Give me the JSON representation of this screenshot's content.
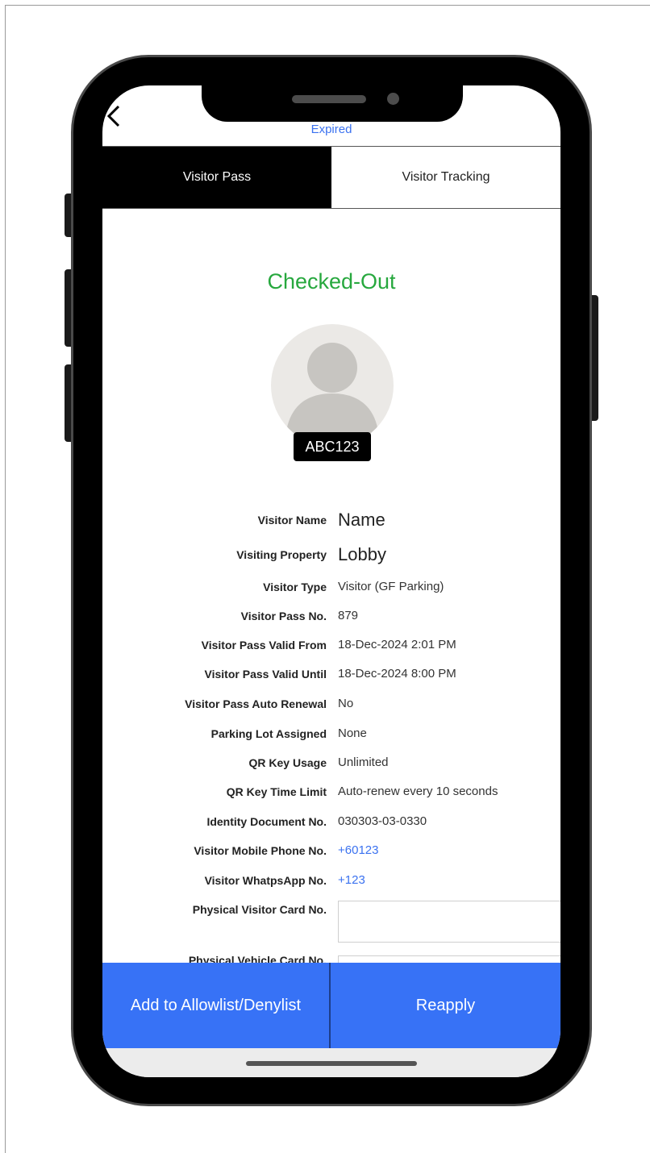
{
  "header": {
    "back_icon": "back-chevron-icon",
    "status_text": "Expired"
  },
  "tabs": [
    {
      "label": "Visitor Pass",
      "active": true
    },
    {
      "label": "Visitor Tracking",
      "active": false
    }
  ],
  "pass": {
    "status": "Checked-Out",
    "status_color": "#27a83e",
    "avatar_icon": "user-avatar-icon",
    "plate_number": "ABC123"
  },
  "details": {
    "visitor_name": {
      "label": "Visitor Name",
      "value": "Name"
    },
    "visiting_property": {
      "label": "Visiting Property",
      "value": "Lobby"
    },
    "visitor_type": {
      "label": "Visitor Type",
      "value": "Visitor (GF Parking)"
    },
    "pass_no": {
      "label": "Visitor Pass No.",
      "value": "879"
    },
    "valid_from": {
      "label": "Visitor Pass Valid From",
      "value": "18-Dec-2024 2:01 PM"
    },
    "valid_until": {
      "label": "Visitor Pass Valid Until",
      "value": "18-Dec-2024 8:00 PM"
    },
    "auto_renewal": {
      "label": "Visitor Pass Auto Renewal",
      "value": "No"
    },
    "parking_lot": {
      "label": "Parking Lot Assigned",
      "value": "None"
    },
    "qr_usage": {
      "label": "QR Key Usage",
      "value": "Unlimited"
    },
    "qr_time_limit": {
      "label": "QR Key Time Limit",
      "value": "Auto-renew every 10 seconds"
    },
    "identity_doc": {
      "label": "Identity Document No.",
      "value": "030303-03-0330"
    },
    "mobile_phone": {
      "label": "Visitor Mobile Phone No.",
      "value": "+60123"
    },
    "whatsapp": {
      "label": "Visitor WhatpsApp No.",
      "value": "+123"
    },
    "physical_visitor_card": {
      "label": "Physical Visitor Card No.",
      "value": ""
    },
    "physical_vehicle_card": {
      "label": "Physical Vehicle Card No.",
      "value": ""
    }
  },
  "actions": {
    "allowlist_label": "Add to Allowlist/Denylist",
    "reapply_label": "Reapply"
  },
  "colors": {
    "accent_blue": "#3772f6",
    "link_blue": "#3b72f0",
    "success_green": "#27a83e"
  }
}
